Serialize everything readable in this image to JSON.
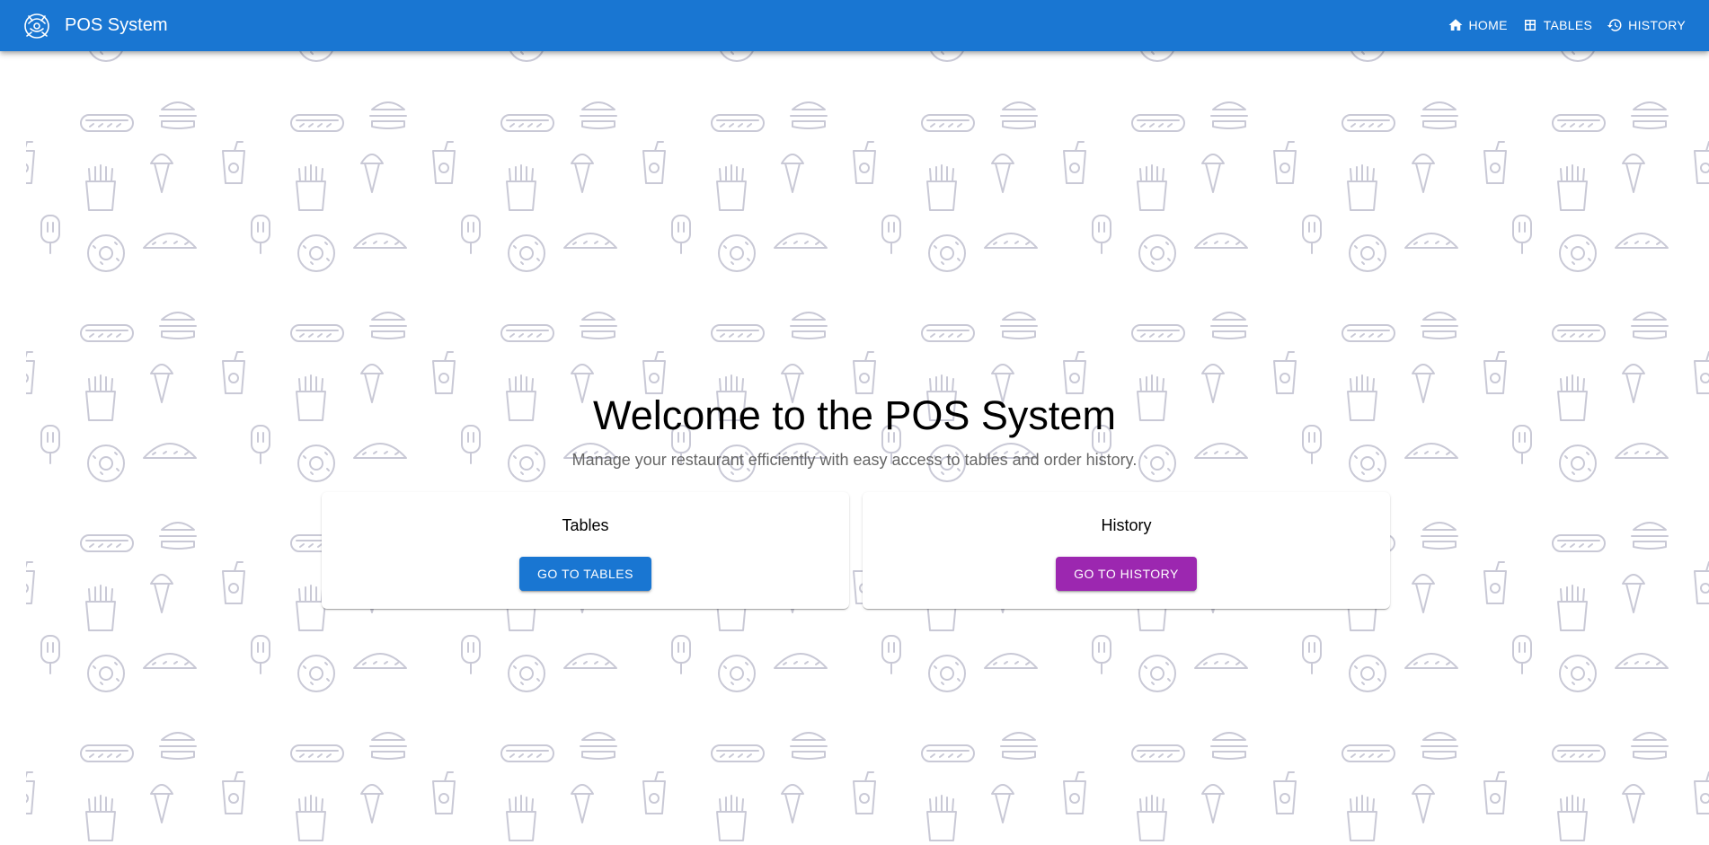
{
  "colors": {
    "primary": "#1976d2",
    "secondary": "#9c27b0",
    "pattern": "#c9c9d6"
  },
  "header": {
    "logo_icon": "chef-logo-icon",
    "title": "POS System",
    "nav": [
      {
        "label": "HOME",
        "icon": "home-icon"
      },
      {
        "label": "TABLES",
        "icon": "table-icon"
      },
      {
        "label": "HISTORY",
        "icon": "history-icon"
      }
    ]
  },
  "background": {
    "icons": [
      "burger-icon",
      "hotdog-icon",
      "drink-cup-icon",
      "fries-icon",
      "ice-cream-cone-icon",
      "taco-icon",
      "popsicle-icon",
      "donut-icon"
    ]
  },
  "hero": {
    "title": "Welcome to the POS System",
    "subtitle": "Manage your restaurant efficiently with easy access to tables and order history."
  },
  "cards": [
    {
      "title": "Tables",
      "button_label": "GO TO TABLES"
    },
    {
      "title": "History",
      "button_label": "GO TO HISTORY"
    }
  ]
}
